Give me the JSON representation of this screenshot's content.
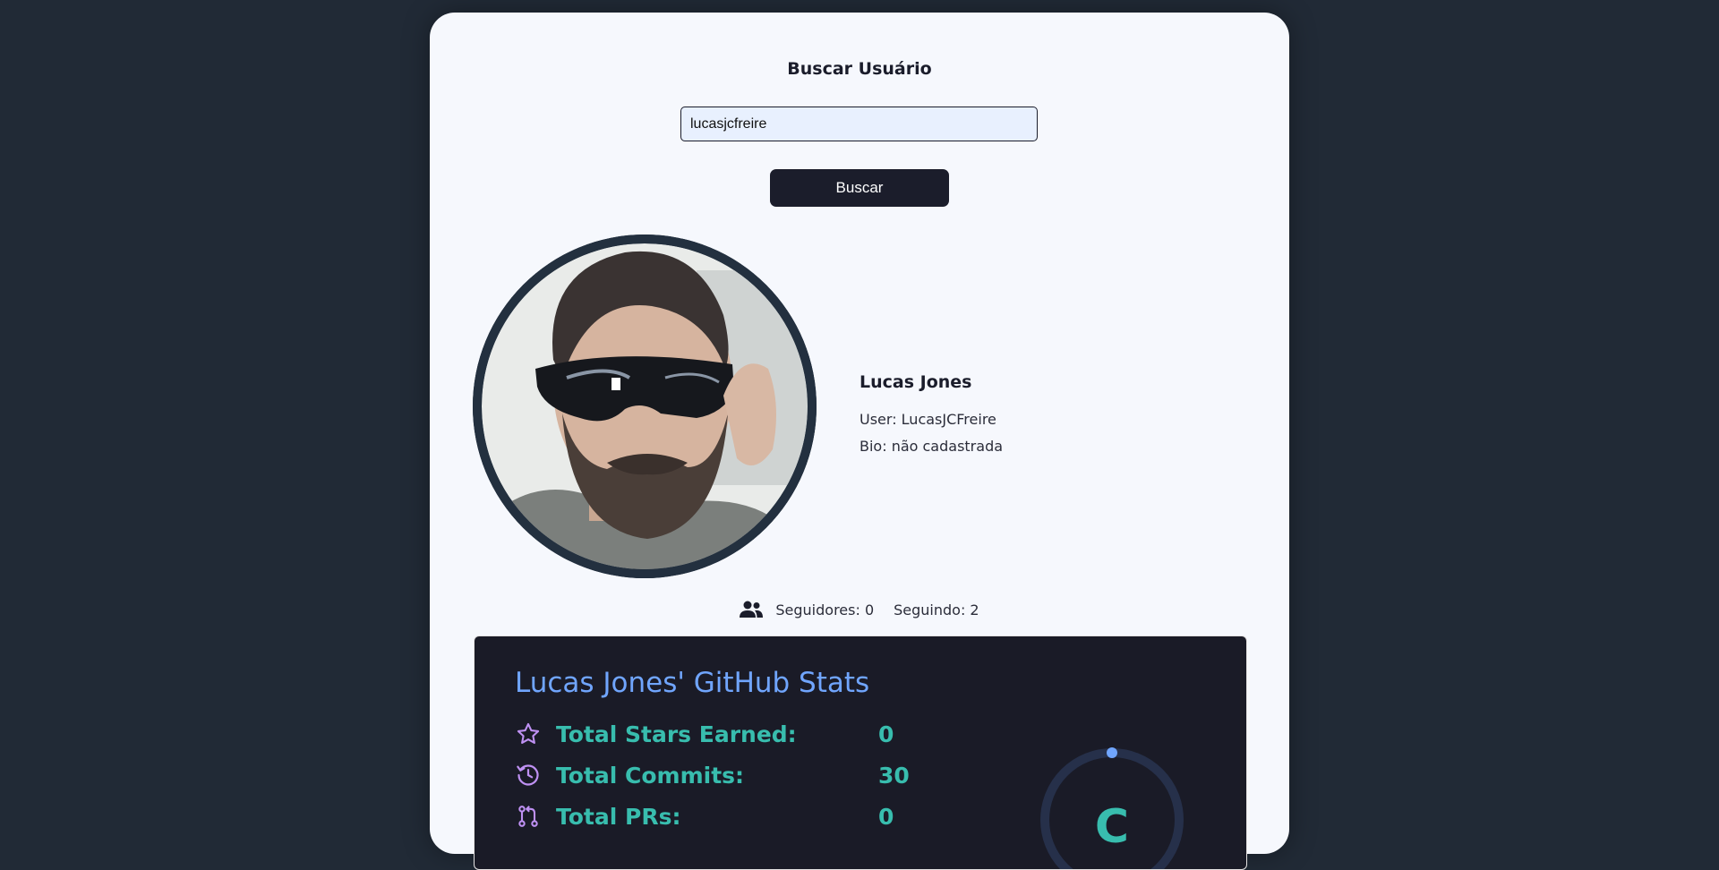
{
  "search": {
    "title": "Buscar Usuário",
    "input_value": "lucasjcfreire",
    "button_label": "Buscar"
  },
  "profile": {
    "name": "Lucas Jones",
    "user_line": "User: LucasJCFreire",
    "bio_line": "Bio: não cadastrada",
    "followers": "Seguidores: 0",
    "following": "Seguindo: 2"
  },
  "stats_card": {
    "title": "Lucas Jones' GitHub Stats",
    "rows": [
      {
        "label": "Total Stars Earned:",
        "value": "0",
        "icon": "star-icon"
      },
      {
        "label": "Total Commits:",
        "value": "30",
        "icon": "history-icon"
      },
      {
        "label": "Total PRs:",
        "value": "0",
        "icon": "pull-request-icon"
      }
    ],
    "rank_letter": "C",
    "colors": {
      "title": "#70a5fd",
      "text": "#38bdae",
      "icon": "#bf91f3",
      "background": "#1a1b27"
    }
  }
}
